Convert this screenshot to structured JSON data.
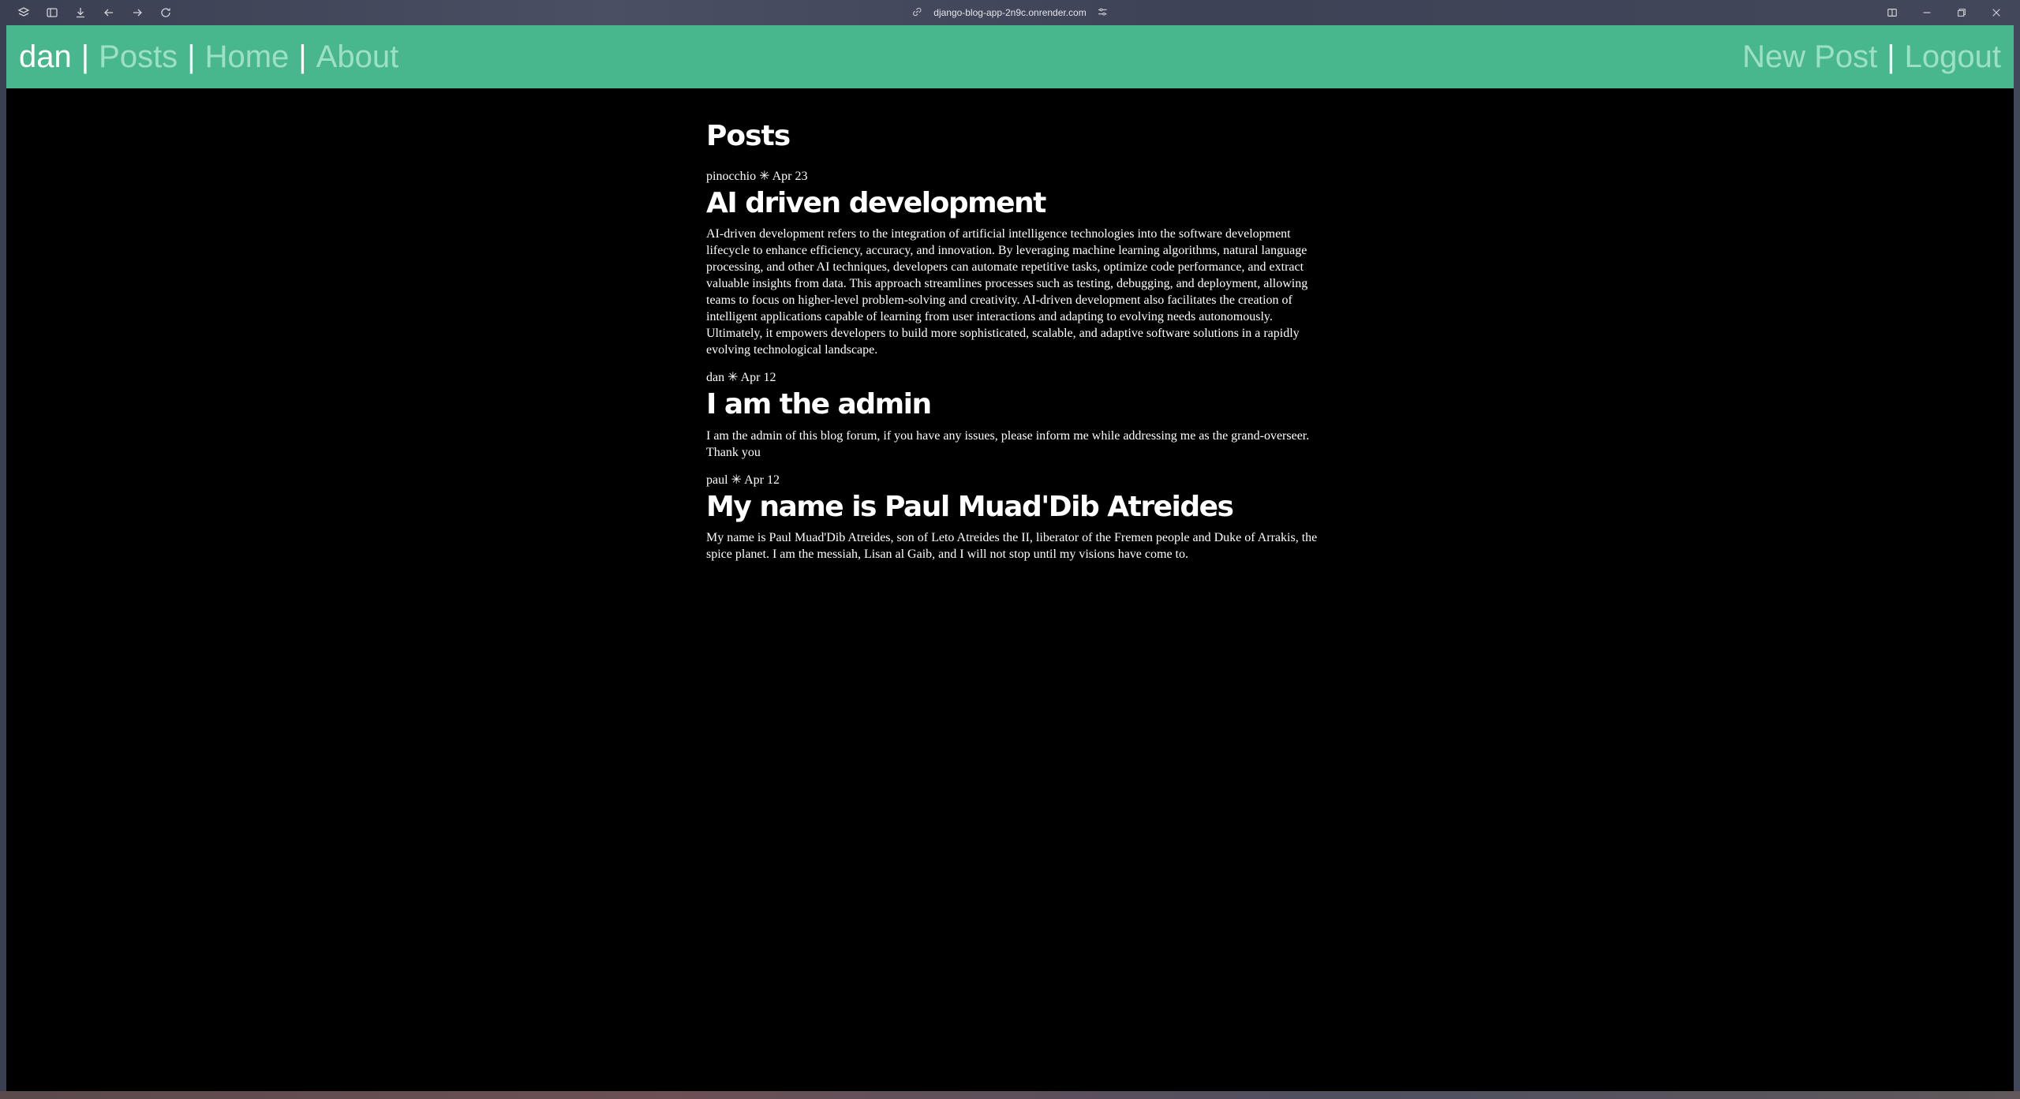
{
  "browser": {
    "url": "django-blog-app-2n9c.onrender.com"
  },
  "nav": {
    "user": "dan",
    "separator": "|",
    "links": [
      "Posts",
      "Home",
      "About"
    ],
    "new_post": "New Post",
    "logout": "Logout",
    "accent_color": "#48b78d"
  },
  "page": {
    "title": "Posts"
  },
  "posts": [
    {
      "meta": "pinocchio ✳ Apr 23",
      "title": "AI driven development",
      "body": "AI-driven development refers to the integration of artificial intelligence technologies into the software development lifecycle to enhance efficiency, accuracy, and innovation. By leveraging machine learning algorithms, natural language processing, and other AI techniques, developers can automate repetitive tasks, optimize code performance, and extract valuable insights from data. This approach streamlines processes such as testing, debugging, and deployment, allowing teams to focus on higher-level problem-solving and creativity. AI-driven development also facilitates the creation of intelligent applications capable of learning from user interactions and adapting to evolving needs autonomously. Ultimately, it empowers developers to build more sophisticated, scalable, and adaptive software solutions in a rapidly evolving technological landscape."
    },
    {
      "meta": "dan ✳ Apr 12",
      "title": "I am the admin",
      "body": "I am the admin of this blog forum, if you have any issues, please inform me while addressing me as the grand-overseer. Thank you"
    },
    {
      "meta": "paul ✳ Apr 12",
      "title": "My name is Paul Muad'Dib Atreides",
      "body": "My name is Paul Muad'Dib Atreides, son of Leto Atreides the II, liberator of the Fremen people and Duke of Arrakis, the spice planet. I am the messiah, Lisan al Gaib, and I will not stop until my visions have come to."
    }
  ]
}
